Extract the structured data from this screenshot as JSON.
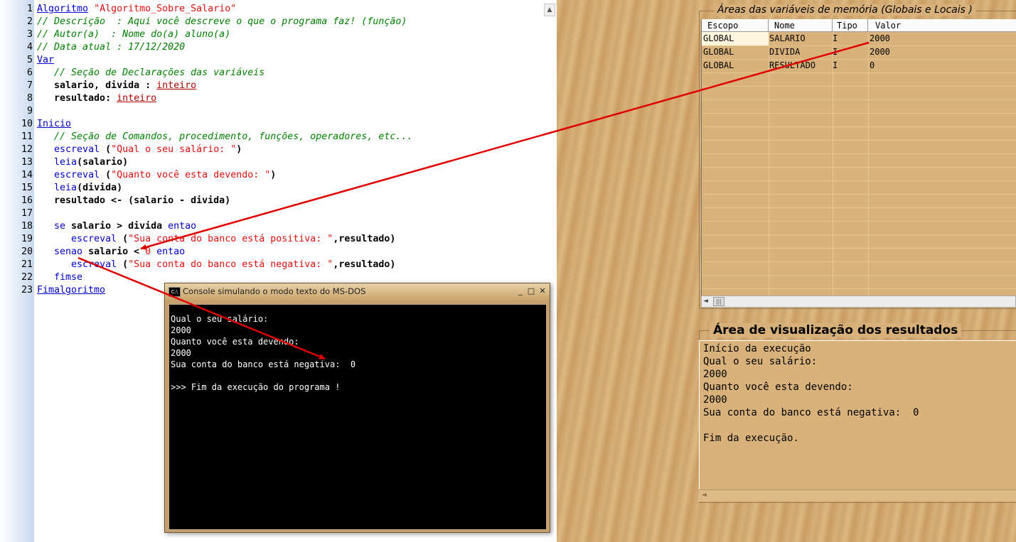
{
  "editor": {
    "lines": [
      {
        "n": "1",
        "parts": [
          {
            "t": "Algoritmo",
            "c": "kw"
          },
          {
            "t": " ",
            "c": ""
          },
          {
            "t": "\"Algoritmo_Sobre_Salario\"",
            "c": "str"
          }
        ]
      },
      {
        "n": "2",
        "parts": [
          {
            "t": "// Descrição  : Aqui você descreve o que o programa faz! (função)",
            "c": "cm"
          }
        ]
      },
      {
        "n": "3",
        "parts": [
          {
            "t": "// Autor(a)  : Nome do(a) aluno(a)",
            "c": "cm"
          }
        ]
      },
      {
        "n": "4",
        "parts": [
          {
            "t": "// Data atual : 17/12/2020",
            "c": "cm"
          }
        ]
      },
      {
        "n": "5",
        "parts": [
          {
            "t": "Var",
            "c": "kw"
          }
        ]
      },
      {
        "n": "6",
        "parts": [
          {
            "t": "   // Seção de Declarações das variáveis",
            "c": "cm"
          }
        ]
      },
      {
        "n": "7",
        "parts": [
          {
            "t": "   salario, divida : ",
            "c": "bd"
          },
          {
            "t": "inteiro",
            "c": "ty"
          }
        ]
      },
      {
        "n": "8",
        "parts": [
          {
            "t": "   resultado: ",
            "c": "bd"
          },
          {
            "t": "inteiro",
            "c": "ty"
          }
        ]
      },
      {
        "n": "9",
        "parts": []
      },
      {
        "n": "10",
        "parts": [
          {
            "t": "Inicio",
            "c": "kw"
          }
        ]
      },
      {
        "n": "11",
        "parts": [
          {
            "t": "   // Seção de Comandos, procedimento, funções, operadores, etc...",
            "c": "cm"
          }
        ]
      },
      {
        "n": "12",
        "parts": [
          {
            "t": "   ",
            "c": ""
          },
          {
            "t": "escreval",
            "c": "fn"
          },
          {
            "t": " (",
            "c": "bd"
          },
          {
            "t": "\"Qual o seu salário: \"",
            "c": "str"
          },
          {
            "t": ")",
            "c": "bd"
          }
        ]
      },
      {
        "n": "13",
        "parts": [
          {
            "t": "   ",
            "c": ""
          },
          {
            "t": "leia",
            "c": "fn"
          },
          {
            "t": "(salario)",
            "c": "bd"
          }
        ]
      },
      {
        "n": "14",
        "parts": [
          {
            "t": "   ",
            "c": ""
          },
          {
            "t": "escreval",
            "c": "fn"
          },
          {
            "t": " (",
            "c": "bd"
          },
          {
            "t": "\"Quanto você esta devendo: \"",
            "c": "str"
          },
          {
            "t": ")",
            "c": "bd"
          }
        ]
      },
      {
        "n": "15",
        "parts": [
          {
            "t": "   ",
            "c": ""
          },
          {
            "t": "leia",
            "c": "fn"
          },
          {
            "t": "(divida)",
            "c": "bd"
          }
        ]
      },
      {
        "n": "16",
        "parts": [
          {
            "t": "   resultado <- (salario - divida)",
            "c": "bd"
          }
        ]
      },
      {
        "n": "17",
        "parts": []
      },
      {
        "n": "18",
        "parts": [
          {
            "t": "   ",
            "c": ""
          },
          {
            "t": "se",
            "c": "fn"
          },
          {
            "t": " salario > divida ",
            "c": "bd"
          },
          {
            "t": "entao",
            "c": "fn"
          }
        ]
      },
      {
        "n": "19",
        "parts": [
          {
            "t": "      ",
            "c": ""
          },
          {
            "t": "escreval",
            "c": "fn"
          },
          {
            "t": " (",
            "c": "bd"
          },
          {
            "t": "\"Sua conta do banco está positiva: \"",
            "c": "str"
          },
          {
            "t": ",resultado)",
            "c": "bd"
          }
        ]
      },
      {
        "n": "20",
        "parts": [
          {
            "t": "   ",
            "c": ""
          },
          {
            "t": "senao",
            "c": "fn"
          },
          {
            "t": " salario < ",
            "c": "bd"
          },
          {
            "t": "0",
            "c": "num"
          },
          {
            "t": " ",
            "c": ""
          },
          {
            "t": "entao",
            "c": "fn"
          }
        ]
      },
      {
        "n": "21",
        "parts": [
          {
            "t": "      ",
            "c": ""
          },
          {
            "t": "escreval",
            "c": "fn"
          },
          {
            "t": " (",
            "c": "bd"
          },
          {
            "t": "\"Sua conta do banco está negativa: \"",
            "c": "str"
          },
          {
            "t": ",resultado)",
            "c": "bd"
          }
        ]
      },
      {
        "n": "22",
        "parts": [
          {
            "t": "   ",
            "c": ""
          },
          {
            "t": "fimse",
            "c": "fn"
          }
        ]
      },
      {
        "n": "23",
        "parts": [
          {
            "t": "Fimalgoritmo",
            "c": "kw"
          }
        ]
      }
    ],
    "scroll_up_glyph": "▲"
  },
  "console": {
    "icon_text": "C:\\",
    "title": "Console simulando o modo texto do MS-DOS",
    "minimize": "_",
    "maximize": "□",
    "close": "✕",
    "lines": [
      "Qual o seu salário:",
      "2000",
      "Quanto você esta devendo:",
      "2000",
      "Sua conta do banco está negativa:  0",
      "",
      ">>> Fim da execução do programa !"
    ]
  },
  "variables": {
    "title": "Áreas das variáveis de memória (Globais e Locais )",
    "columns": [
      "Escopo",
      "Nome",
      "Tipo",
      "Valor"
    ],
    "rows": [
      [
        "GLOBAL",
        "SALARIO",
        "I",
        "2000"
      ],
      [
        "GLOBAL",
        "DIVIDA",
        "I",
        "2000"
      ],
      [
        "GLOBAL",
        "RESULTADO",
        "I",
        "0"
      ]
    ],
    "scroll_left_glyph": "◄",
    "scroll_thumb_glyph": "|||"
  },
  "results": {
    "title": "Área de visualização dos resultados",
    "lines": [
      "Início da execução",
      "Qual o seu salário:",
      "2000",
      "Quanto você esta devendo:",
      "2000",
      "Sua conta do banco está negativa:  0",
      "",
      "Fim da execução."
    ],
    "scroll_left_glyph": "◄"
  },
  "colors": {
    "arrow": "#e00000",
    "keyword": "#0000cc",
    "string": "#e01010",
    "comment": "#008000",
    "type": "#b00000"
  }
}
